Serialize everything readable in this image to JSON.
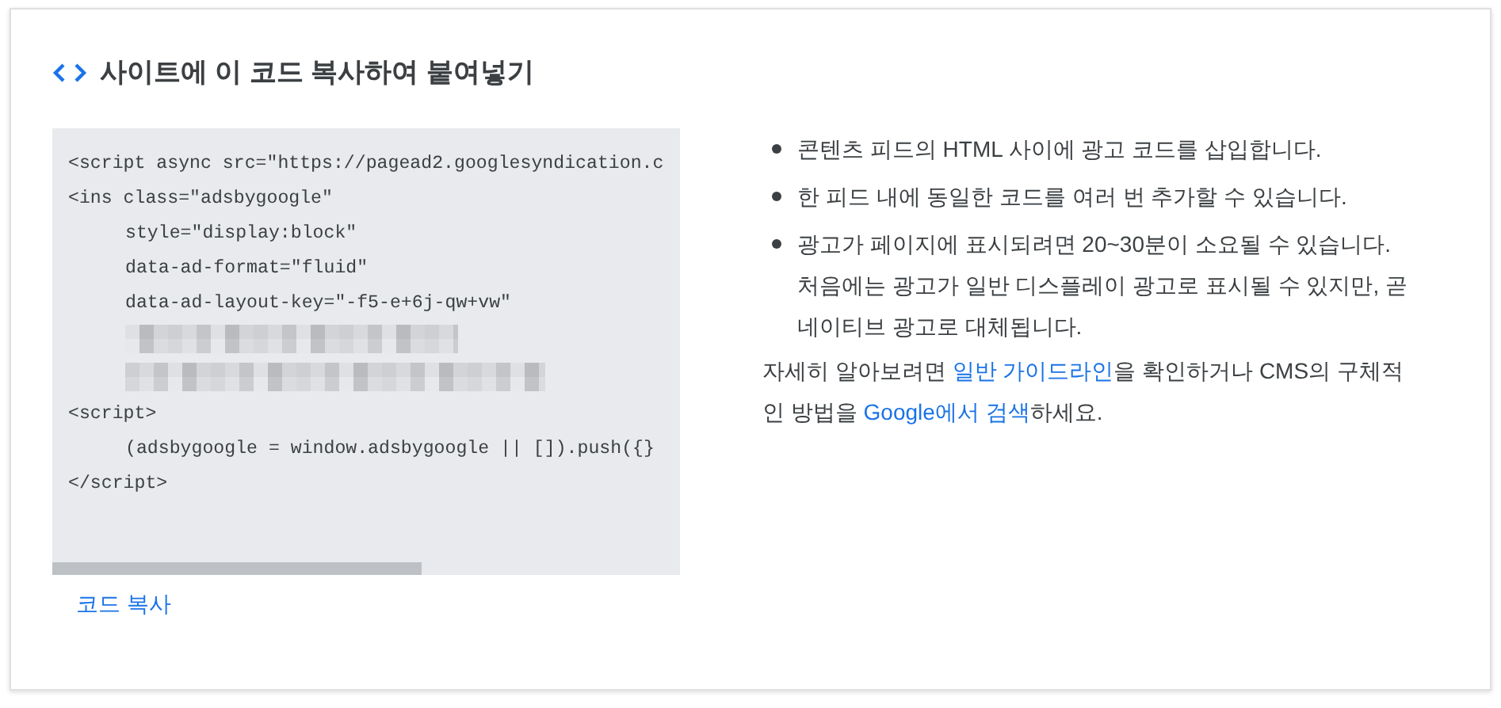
{
  "title": "사이트에 이 코드 복사하여 붙여넣기",
  "code_lines": [
    {
      "kind": "code",
      "indented": false,
      "text": "<script async src=\"https://pagead2.googlesyndication.c"
    },
    {
      "kind": "code",
      "indented": false,
      "text": "<ins class=\"adsbygoogle\""
    },
    {
      "kind": "code",
      "indented": true,
      "text": "style=\"display:block\""
    },
    {
      "kind": "code",
      "indented": true,
      "text": "data-ad-format=\"fluid\""
    },
    {
      "kind": "code",
      "indented": true,
      "text": "data-ad-layout-key=\"-f5-e+6j-qw+vw\""
    },
    {
      "kind": "redacted",
      "indented": true
    },
    {
      "kind": "redacted",
      "indented": true
    },
    {
      "kind": "code",
      "indented": false,
      "text": "<script>"
    },
    {
      "kind": "code",
      "indented": true,
      "text": "(adsbygoogle = window.adsbygoogle || []).push({}"
    },
    {
      "kind": "code",
      "indented": false,
      "text": "</script>"
    }
  ],
  "copy_link": "코드 복사",
  "bullets": [
    "콘텐츠 피드의 HTML 사이에 광고 코드를 삽입합니다.",
    "한 피드 내에 동일한 코드를 여러 번 추가할 수 있습니다.",
    "광고가 페이지에 표시되려면 20~30분이 소요될 수 있습니다. 처음에는 광고가 일반 디스플레이 광고로 표시될 수 있지만, 곧 네이티브 광고로 대체됩니다."
  ],
  "note": [
    {
      "text": "자세히 알아보려면 ",
      "link": false
    },
    {
      "text": "일반 가이드라인",
      "link": true
    },
    {
      "text": "을 확인하거나 CMS의 구체적인 방법을 ",
      "link": false
    },
    {
      "text": "Google에서 검색",
      "link": true
    },
    {
      "text": "하세요.",
      "link": false
    }
  ]
}
